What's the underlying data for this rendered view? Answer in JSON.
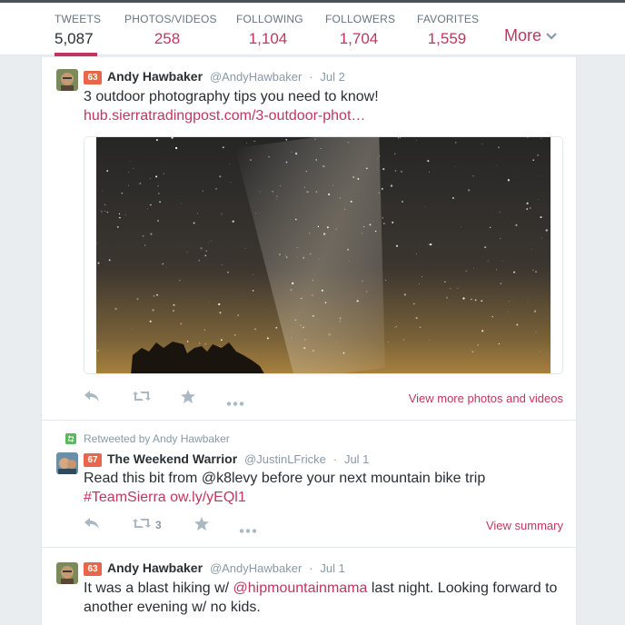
{
  "profile_nav": {
    "items": [
      {
        "label": "TWEETS",
        "value": "5,087",
        "active": true
      },
      {
        "label": "PHOTOS/VIDEOS",
        "value": "258"
      },
      {
        "label": "FOLLOWING",
        "value": "1,104"
      },
      {
        "label": "FOLLOWERS",
        "value": "1,704"
      },
      {
        "label": "FAVORITES",
        "value": "1,559"
      }
    ],
    "more_label": "More"
  },
  "tweets": [
    {
      "badge": "63",
      "fullname": "Andy Hawbaker",
      "username": "@AndyHawbaker",
      "separator": "·",
      "time": "Jul 2",
      "text": "3 outdoor photography tips you need to know!",
      "link": "hub.sierratradingpost.com/3-outdoor-phot…",
      "media_alt": "Milky Way night sky over rock silhouettes",
      "action_link": "View more photos and videos"
    },
    {
      "retweet_context": "Retweeted by Andy Hawbaker",
      "badge": "67",
      "fullname": "The Weekend Warrior",
      "username": "@JustinLFricke",
      "separator": "·",
      "time": "Jul 1",
      "text": "Read this bit from @k8levy before your next mountain bike trip",
      "hashtag": "#TeamSierra",
      "link": "ow.ly/yEQl1",
      "retweet_count": "3",
      "action_link": "View summary"
    },
    {
      "badge": "63",
      "fullname": "Andy Hawbaker",
      "username": "@AndyHawbaker",
      "separator": "·",
      "time": "Jul 1",
      "text_before": "It was a blast hiking w/",
      "mention": "@hipmountainmama",
      "text_after": "last night. Looking forward to another evening w/ no kids."
    }
  ],
  "colors": {
    "accent": "#c0365e",
    "badge": "#e8674a",
    "muted": "#8899a6",
    "text": "#292f33",
    "icon": "#aab8c2",
    "retweet_green": "#5cb85c"
  }
}
